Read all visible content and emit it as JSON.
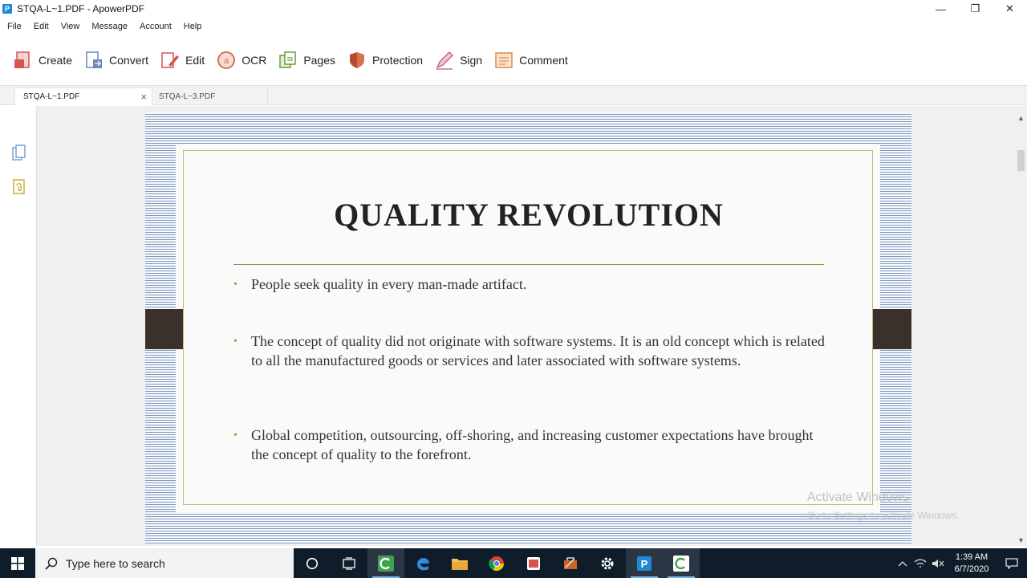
{
  "window": {
    "title": "STQA-L~1.PDF - ApowerPDF",
    "app_icon_letter": "P",
    "minimize": "—",
    "maximize": "❐",
    "close": "✕"
  },
  "menu": [
    "File",
    "Edit",
    "View",
    "Message",
    "Account",
    "Help"
  ],
  "toolbar": [
    {
      "label": "Create",
      "icon": "create-icon"
    },
    {
      "label": "Convert",
      "icon": "convert-icon"
    },
    {
      "label": "Edit",
      "icon": "edit-icon"
    },
    {
      "label": "OCR",
      "icon": "ocr-icon"
    },
    {
      "label": "Pages",
      "icon": "pages-icon"
    },
    {
      "label": "Protection",
      "icon": "shield-icon"
    },
    {
      "label": "Sign",
      "icon": "sign-icon"
    },
    {
      "label": "Comment",
      "icon": "comment-icon"
    }
  ],
  "tabs": [
    {
      "label": "STQA-L~1.PDF",
      "active": true,
      "close": "×"
    },
    {
      "label": "STQA-L~3.PDF",
      "active": false
    }
  ],
  "slide": {
    "title": "QUALITY REVOLUTION",
    "bullets": [
      "People seek quality in every man-made artifact.",
      "The concept of quality did not originate with software systems. It is an old concept which is related to all the manufactured goods or services and later associated with software systems.",
      "Global competition, outsourcing, off-shoring, and increasing customer expectations have brought the concept of quality to the forefront."
    ],
    "bullet_glyph": "•"
  },
  "watermark": {
    "line1": "Activate Windows",
    "line2": "Go to Settings to activate Windows."
  },
  "scrollbar": {
    "up": "▲",
    "down": "▼"
  },
  "taskbar": {
    "search_placeholder": "Type here to search",
    "clock_time": "1:39 AM",
    "clock_date": "6/7/2020"
  },
  "colors": {
    "accent_red": "#d9534f",
    "frame_green": "#b7c27a",
    "bullet_green": "#8ab030",
    "taskbar": "#0f1c2a"
  }
}
